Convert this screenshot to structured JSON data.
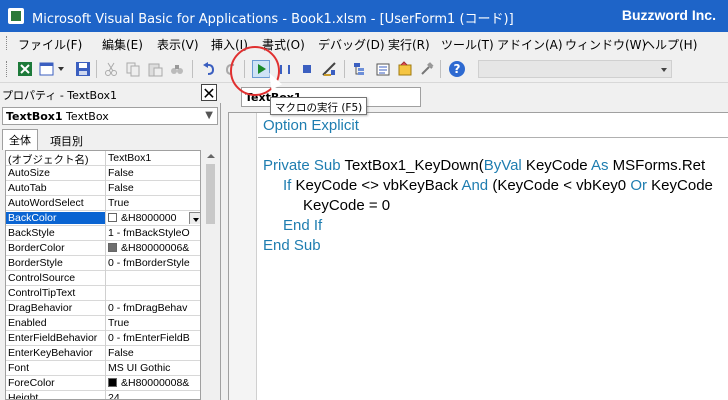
{
  "window": {
    "title": "Microsoft Visual Basic for Applications - Book1.xlsm - [UserForm1 (コード)]",
    "brand": "Buzzword Inc."
  },
  "menu": [
    "ファイル(F)",
    "編集(E)",
    "表示(V)",
    "挿入(I)",
    "書式(O)",
    "デバッグ(D)",
    "実行(R)",
    "ツール(T)",
    "アドイン(A)",
    "ウィンドウ(W)",
    "ヘルプ(H)"
  ],
  "toolbar": {
    "run_tooltip": "マクロの実行 (F5)",
    "help_label": "?"
  },
  "properties": {
    "title": "プロパティ - TextBox1",
    "close_label": "✕",
    "object_name": "TextBox1",
    "object_type": "TextBox",
    "tabs": [
      "全体",
      "項目別"
    ],
    "rows": [
      {
        "name": "(オブジェクト名)",
        "value": "TextBox1"
      },
      {
        "name": "AutoSize",
        "value": "False"
      },
      {
        "name": "AutoTab",
        "value": "False"
      },
      {
        "name": "AutoWordSelect",
        "value": "True"
      },
      {
        "name": "BackColor",
        "value": "&H8000000",
        "swatch": "#ffffff"
      },
      {
        "name": "BackStyle",
        "value": "1 - fmBackStyleO"
      },
      {
        "name": "BorderColor",
        "value": "&H80000006&",
        "swatch": "#6e6e6e"
      },
      {
        "name": "BorderStyle",
        "value": "0 - fmBorderStyle"
      },
      {
        "name": "ControlSource",
        "value": ""
      },
      {
        "name": "ControlTipText",
        "value": ""
      },
      {
        "name": "DragBehavior",
        "value": "0 - fmDragBehav"
      },
      {
        "name": "Enabled",
        "value": "True"
      },
      {
        "name": "EnterFieldBehavior",
        "value": "0 - fmEnterFieldB"
      },
      {
        "name": "EnterKeyBehavior",
        "value": "False"
      },
      {
        "name": "Font",
        "value": "MS UI Gothic"
      },
      {
        "name": "ForeColor",
        "value": "&H80000008&",
        "swatch": "#000000"
      },
      {
        "name": "Height",
        "value": "24"
      }
    ]
  },
  "code": {
    "object_combo": "TextBox1",
    "lines": [
      {
        "indent": 0,
        "parts": [
          {
            "t": "Option Explicit",
            "k": true
          }
        ]
      },
      {
        "indent": 0,
        "parts": [
          {
            "t": "",
            "k": false
          }
        ]
      },
      {
        "indent": 0,
        "parts": [
          {
            "t": "Private Sub ",
            "k": true
          },
          {
            "t": "TextBox1_KeyDown(",
            "k": false
          },
          {
            "t": "ByVal",
            "k": true
          },
          {
            "t": " KeyCode ",
            "k": false
          },
          {
            "t": "As",
            "k": true
          },
          {
            "t": " MSForms.Ret",
            "k": false
          }
        ]
      },
      {
        "indent": 1,
        "parts": [
          {
            "t": "If",
            "k": true
          },
          {
            "t": " KeyCode <> vbKeyBack ",
            "k": false
          },
          {
            "t": "And",
            "k": true
          },
          {
            "t": " (KeyCode < vbKey0 ",
            "k": false
          },
          {
            "t": "Or",
            "k": true
          },
          {
            "t": " KeyCode",
            "k": false
          }
        ]
      },
      {
        "indent": 2,
        "parts": [
          {
            "t": "KeyCode = 0",
            "k": false
          }
        ]
      },
      {
        "indent": 1,
        "parts": [
          {
            "t": "End If",
            "k": true
          }
        ]
      },
      {
        "indent": 0,
        "parts": [
          {
            "t": "End Sub",
            "k": true
          }
        ]
      }
    ]
  }
}
